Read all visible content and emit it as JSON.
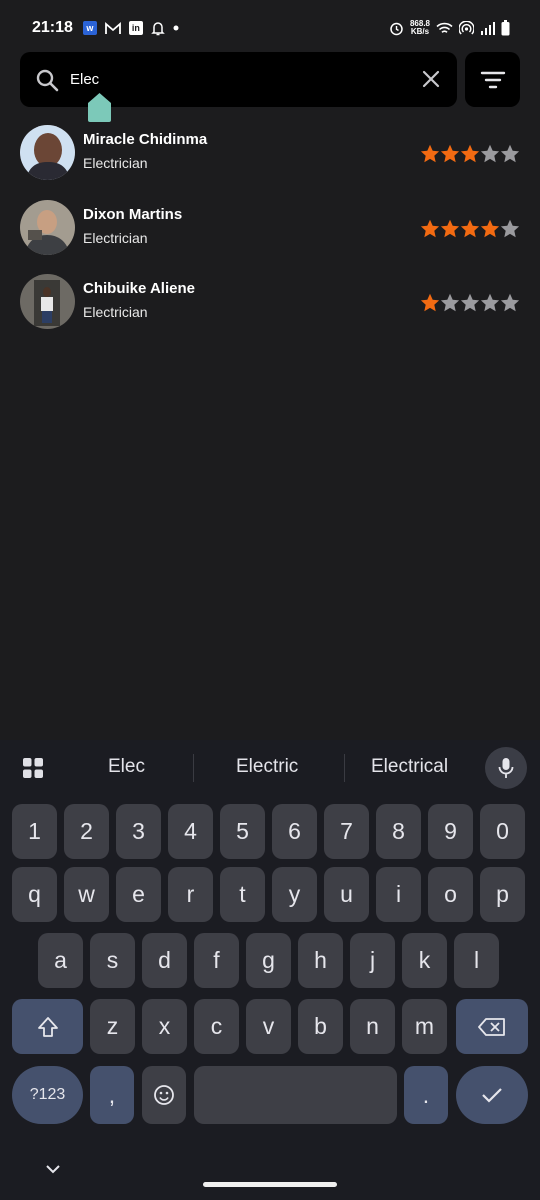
{
  "status_bar": {
    "time": "21:18",
    "left_icons": [
      "w-app-icon",
      "gmail-icon",
      "linkedin-icon",
      "notification-bell-icon",
      "dot-icon"
    ],
    "net_speed_value": "868.8",
    "net_speed_unit": "KB/s",
    "right_icons": [
      "alarm-icon",
      "wifi-icon",
      "hotspot-icon",
      "signal-icon",
      "battery-icon"
    ]
  },
  "search": {
    "value": "Elec",
    "icon": "search-icon",
    "clear_icon": "close-icon"
  },
  "filter": {
    "icon": "filter-icon"
  },
  "results": [
    {
      "name": "Miracle Chidinma",
      "role": "Electrician",
      "rating": 3,
      "max_rating": 5
    },
    {
      "name": "Dixon Martins",
      "role": "Electrician",
      "rating": 4,
      "max_rating": 5
    },
    {
      "name": "Chibuike Aliene",
      "role": "Electrician",
      "rating": 1,
      "max_rating": 5
    }
  ],
  "colors": {
    "star_filled": "#f26a12",
    "star_empty": "#9a9a9e",
    "background": "#1c1c1e",
    "cursor_handle": "#7cc9b9"
  },
  "keyboard": {
    "suggestions": [
      "Elec",
      "Electric",
      "Electrical"
    ],
    "row_numbers": [
      "1",
      "2",
      "3",
      "4",
      "5",
      "6",
      "7",
      "8",
      "9",
      "0"
    ],
    "row1": [
      "q",
      "w",
      "e",
      "r",
      "t",
      "y",
      "u",
      "i",
      "o",
      "p"
    ],
    "row2": [
      "a",
      "s",
      "d",
      "f",
      "g",
      "h",
      "j",
      "k",
      "l"
    ],
    "row3": [
      "z",
      "x",
      "c",
      "v",
      "b",
      "n",
      "m"
    ],
    "symbols_label": "?123",
    "comma": ",",
    "period": "."
  }
}
